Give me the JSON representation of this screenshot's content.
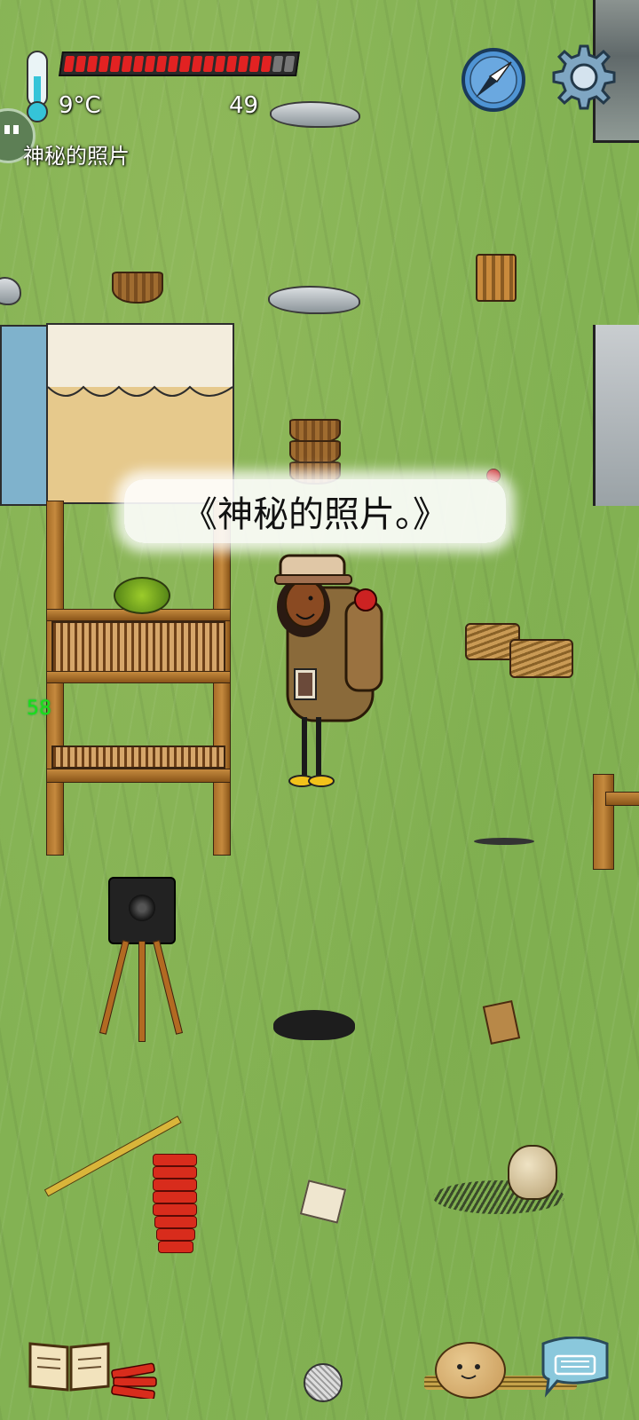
{
  "hud": {
    "temperature": "9°C",
    "age": "49",
    "held_item_label": "神秘的照片",
    "food_pips_total": 20,
    "food_pips_filled": 18,
    "compass_icon": "compass-icon",
    "settings_icon": "gear-icon",
    "emote_icon": "emote-face-icon",
    "thermometer_icon": "thermometer-icon"
  },
  "speech": {
    "text": "《神秘的照片。》"
  },
  "world": {
    "counter_value": "58"
  },
  "toolbar": {
    "book_icon": "book-icon",
    "keyboard_icon": "keyboard-icon"
  },
  "colors": {
    "grass": "#83b253",
    "food_bar_fill": "#e22222",
    "thermometer_fluid": "#35c4d8",
    "counter_green": "#18e018"
  }
}
